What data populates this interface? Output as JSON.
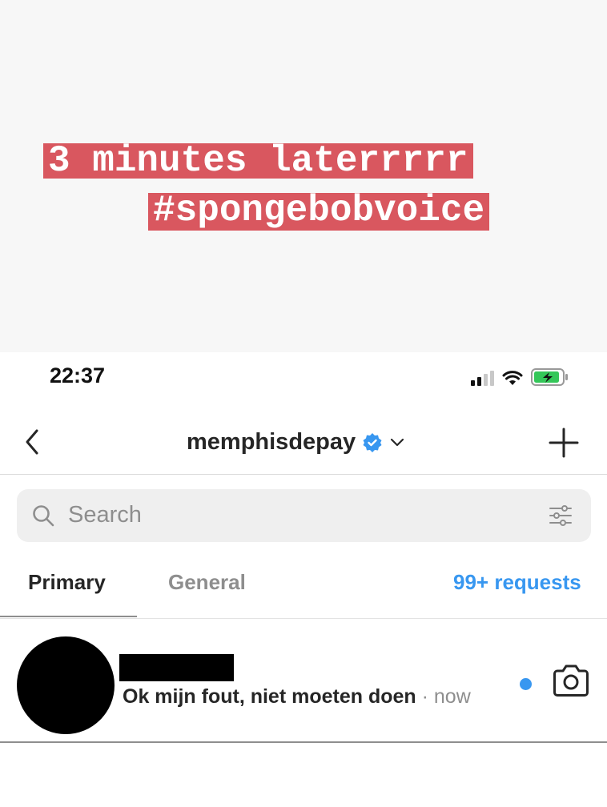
{
  "meme": {
    "line1": "3 minutes laterrrrr",
    "line2": "#spongebobvoice"
  },
  "status_bar": {
    "time": "22:37",
    "icons": [
      "cellular-signal-icon",
      "wifi-icon",
      "battery-charging-icon"
    ]
  },
  "header": {
    "username": "memphisdepay",
    "icons": [
      "back-chevron-icon",
      "verified-badge-icon",
      "chevron-down-icon",
      "plus-icon"
    ]
  },
  "search": {
    "placeholder": "Search",
    "icons": [
      "search-icon",
      "filter-sliders-icon"
    ]
  },
  "tabs": [
    {
      "label": "Primary",
      "active": true
    },
    {
      "label": "General",
      "active": false
    },
    {
      "label": "99+ requests",
      "active": false
    }
  ],
  "conversations": [
    {
      "name": "",
      "preview": "Ok mijn fout, niet moeten doen",
      "separator": " · ",
      "time": "now",
      "unread": true,
      "action_icon": "camera-icon"
    }
  ],
  "colors": {
    "caption_bg": "#d9575f",
    "accent_blue": "#3897f0",
    "verified_blue": "#3897f0"
  }
}
